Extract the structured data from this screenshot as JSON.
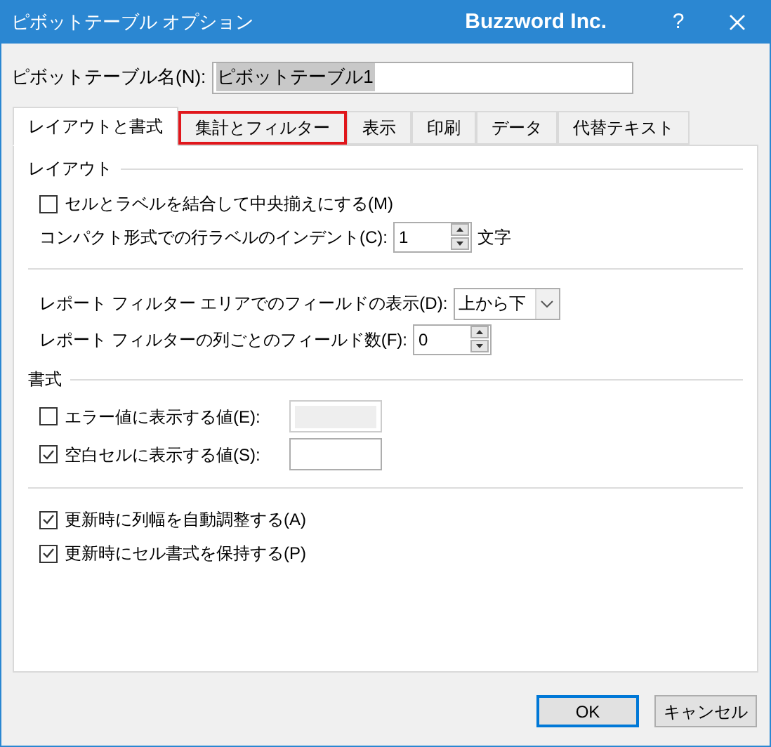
{
  "window": {
    "title": "ピボットテーブル オプション",
    "brand": "Buzzword Inc.",
    "help": "?"
  },
  "name_field": {
    "label": "ピボットテーブル名(N):",
    "value": "ピボットテーブル1",
    "text_selected": true
  },
  "tabs": [
    {
      "label": "レイアウトと書式",
      "selected": true,
      "highlighted": false
    },
    {
      "label": "集計とフィルター",
      "selected": false,
      "highlighted": true
    },
    {
      "label": "表示",
      "selected": false,
      "highlighted": false
    },
    {
      "label": "印刷",
      "selected": false,
      "highlighted": false
    },
    {
      "label": "データ",
      "selected": false,
      "highlighted": false
    },
    {
      "label": "代替テキスト",
      "selected": false,
      "highlighted": false
    }
  ],
  "sections": [
    {
      "heading": "レイアウト",
      "controls": [
        {
          "kind": "checkbox",
          "label": "セルとラベルを結合して中央揃えにする(M)",
          "checked": false
        },
        {
          "kind": "spin",
          "label": "コンパクト形式での行ラベルのインデント(C):",
          "value": "1",
          "suffix": "文字"
        },
        {
          "kind": "separator"
        },
        {
          "kind": "dropdown",
          "label": "レポート フィルター エリアでのフィールドの表示(D):",
          "value": "上から下"
        },
        {
          "kind": "spin",
          "label": "レポート フィルターの列ごとのフィールド数(F):",
          "value": "0"
        }
      ]
    },
    {
      "heading": "書式",
      "controls": [
        {
          "kind": "checkbox_field",
          "label": "エラー値に表示する値(E):",
          "checked": false,
          "disabled": true
        },
        {
          "kind": "checkbox_field",
          "label": "空白セルに表示する値(S):",
          "checked": true,
          "disabled": false
        },
        {
          "kind": "separator"
        },
        {
          "kind": "checkbox",
          "label": "更新時に列幅を自動調整する(A)",
          "checked": true
        },
        {
          "kind": "checkbox",
          "label": "更新時にセル書式を保持する(P)",
          "checked": true
        }
      ]
    }
  ],
  "buttons": [
    {
      "label": "OK",
      "default": true
    },
    {
      "label": "キャンセル",
      "default": false
    }
  ]
}
